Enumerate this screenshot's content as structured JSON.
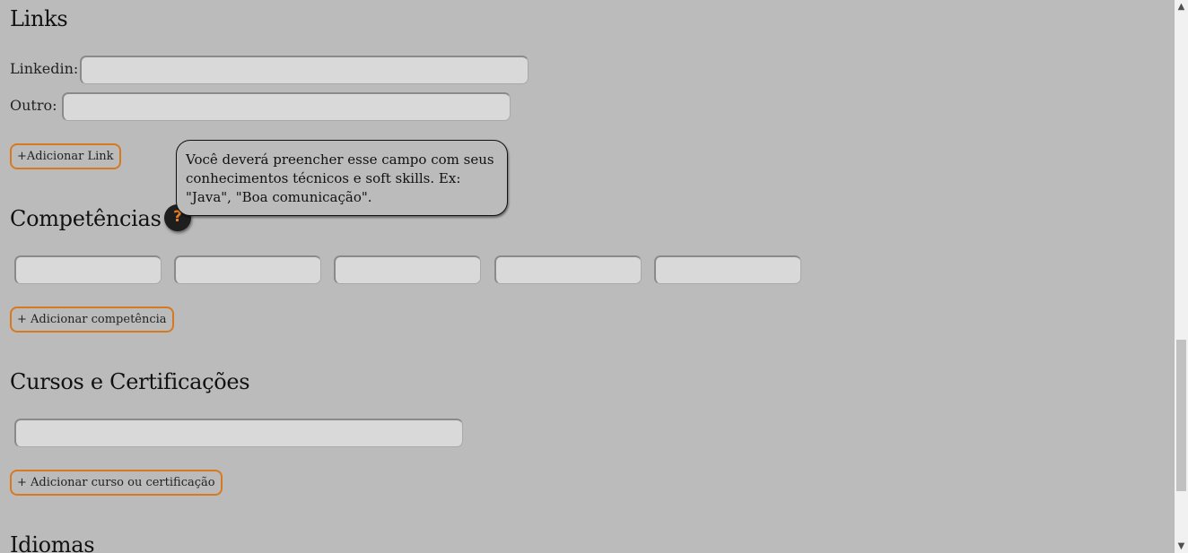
{
  "links": {
    "title": "Links",
    "linkedin_label": "Linkedin:",
    "linkedin_value": "",
    "other_label": "Outro:",
    "other_value": "",
    "add_button": "+Adicionar Link"
  },
  "skills": {
    "title": "Competências",
    "help_glyph": "?",
    "tooltip": "Você deverá preencher esse campo com seus conhecimentos técnicos e soft skills. Ex: \"Java\", \"Boa comunicação\".",
    "fields": [
      "",
      "",
      "",
      "",
      ""
    ],
    "add_button": "+ Adicionar competência"
  },
  "courses": {
    "title": "Cursos e Certificações",
    "field_value": "",
    "add_button": "+ Adicionar curso ou certificação"
  },
  "languages": {
    "title": "Idiomas"
  },
  "colors": {
    "background": "#bbbbbb",
    "field": "#d9d9d9",
    "accent": "#d8791f",
    "help_bg": "#1e1e1e"
  },
  "icons": {
    "help": "question-mark-icon",
    "scroll_up": "chevron-up-icon",
    "scroll_down": "chevron-down-icon"
  }
}
